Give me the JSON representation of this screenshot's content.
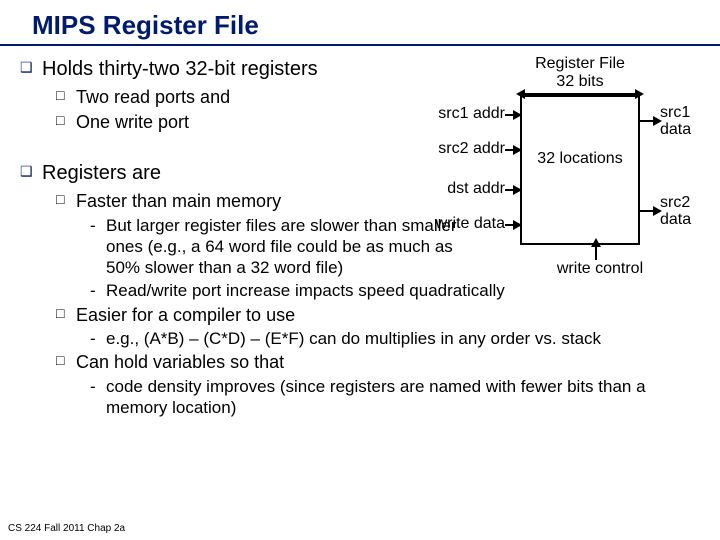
{
  "title": "MIPS Register File",
  "footer": "CS 224 Fall 2011 Chap 2a",
  "bullets": {
    "holds": "Holds thirty-two 32-bit registers",
    "two_read": "Two read ports and",
    "one_write": "One write port",
    "regs_are": "Registers are",
    "faster": "Faster than main memory",
    "faster_note": "But larger register files are slower than smaller ones (e.g., a 64 word file could be as much as 50% slower than a 32 word file)",
    "rw_port": "Read/write port increase impacts speed quadratically",
    "easier": "Easier for a compiler to use",
    "easier_eg": "e.g., (A*B) – (C*D) – (E*F) can do multiplies in any order vs. stack",
    "hold_vars": "Can hold variables so that",
    "hold_vars_note": "code density improves (since registers are named with fewer bits than a memory location)"
  },
  "diagram": {
    "title": "Register File",
    "bits": "32 bits",
    "locations": "32 locations",
    "src1_addr": "src1 addr",
    "src2_addr": "src2 addr",
    "dst_addr": "dst addr",
    "write_data": "write data",
    "src1_data": "src1 data",
    "src2_data": "src2 data",
    "write_control": "write control"
  }
}
